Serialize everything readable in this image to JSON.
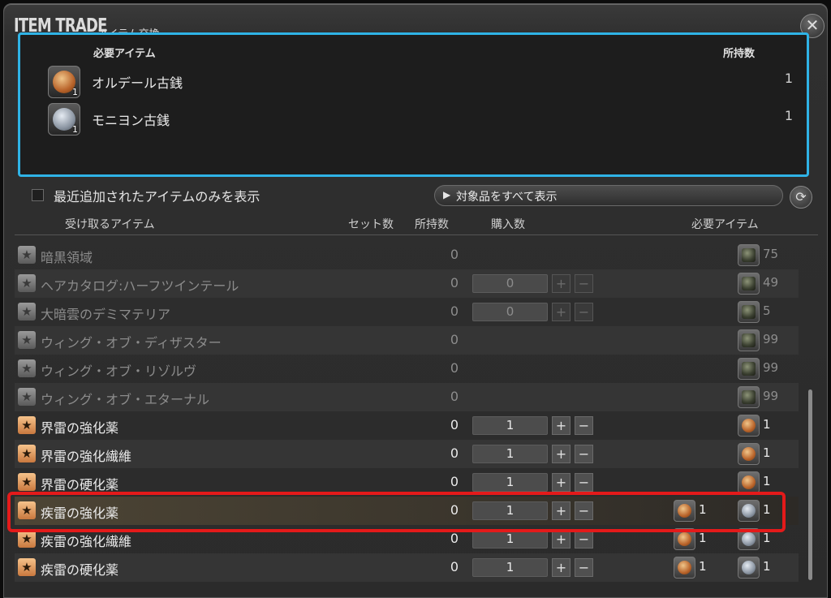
{
  "window": {
    "title": "ITEM TRADE",
    "subtitle": "アイテム交換"
  },
  "required": {
    "header_item": "必要アイテム",
    "header_owned": "所持数",
    "items": [
      {
        "name": "オルデール古銭",
        "owned": "1",
        "icon": "gold-coin-icon",
        "stack": "1"
      },
      {
        "name": "モニヨン古銭",
        "owned": "1",
        "icon": "silver-coin-icon",
        "stack": "1"
      }
    ]
  },
  "filter": {
    "label": "最近追加されたアイテムのみを表示",
    "checked": false
  },
  "show_all": {
    "label": "対象品をすべて表示"
  },
  "columns": {
    "item": "受け取るアイテム",
    "set": "セット数",
    "owned": "所持数",
    "buy": "購入数",
    "required": "必要アイテム"
  },
  "rows": [
    {
      "name": "暗黒領域",
      "owned": "0",
      "qty": "",
      "req": [
        {
          "icon": "dark",
          "count": "75"
        }
      ]
    },
    {
      "name": "ヘアカタログ:ハーフツインテール",
      "owned": "0",
      "qty": "0",
      "req": [
        {
          "icon": "dark",
          "count": "49"
        }
      ]
    },
    {
      "name": "大暗雲のデミマテリア",
      "owned": "0",
      "qty": "0",
      "req": [
        {
          "icon": "dark",
          "count": "5"
        }
      ]
    },
    {
      "name": "ウィング・オブ・ディザスター",
      "owned": "0",
      "qty": "",
      "req": [
        {
          "icon": "dark",
          "count": "99"
        }
      ]
    },
    {
      "name": "ウィング・オブ・リゾルヴ",
      "owned": "0",
      "qty": "",
      "req": [
        {
          "icon": "dark",
          "count": "99"
        }
      ]
    },
    {
      "name": "ウィング・オブ・エターナル",
      "owned": "0",
      "qty": "",
      "req": [
        {
          "icon": "dark",
          "count": "99"
        }
      ]
    },
    {
      "name": "界雷の強化薬",
      "owned": "0",
      "qty": "1",
      "req": [
        {
          "icon": "gold",
          "count": "1"
        }
      ]
    },
    {
      "name": "界雷の強化繊維",
      "owned": "0",
      "qty": "1",
      "req": [
        {
          "icon": "gold",
          "count": "1"
        }
      ]
    },
    {
      "name": "界雷の硬化薬",
      "owned": "0",
      "qty": "1",
      "req": [
        {
          "icon": "gold",
          "count": "1"
        }
      ]
    },
    {
      "name": "疾雷の強化薬",
      "owned": "0",
      "qty": "1",
      "req": [
        {
          "icon": "gold",
          "count": "1"
        },
        {
          "icon": "silver",
          "count": "1"
        }
      ]
    },
    {
      "name": "疾雷の強化繊維",
      "owned": "0",
      "qty": "1",
      "req": [
        {
          "icon": "gold",
          "count": "1"
        },
        {
          "icon": "silver",
          "count": "1"
        }
      ]
    },
    {
      "name": "疾雷の硬化薬",
      "owned": "0",
      "qty": "1",
      "req": [
        {
          "icon": "gold",
          "count": "1"
        },
        {
          "icon": "silver",
          "count": "1"
        }
      ]
    }
  ],
  "buttons": {
    "plus": "+",
    "minus": "−",
    "close": "✕",
    "refresh": "⟳",
    "triangle": "▶",
    "star": "★"
  },
  "colors": {
    "highlight": "#e41a1a",
    "panel_border": "#2fb3e6"
  }
}
